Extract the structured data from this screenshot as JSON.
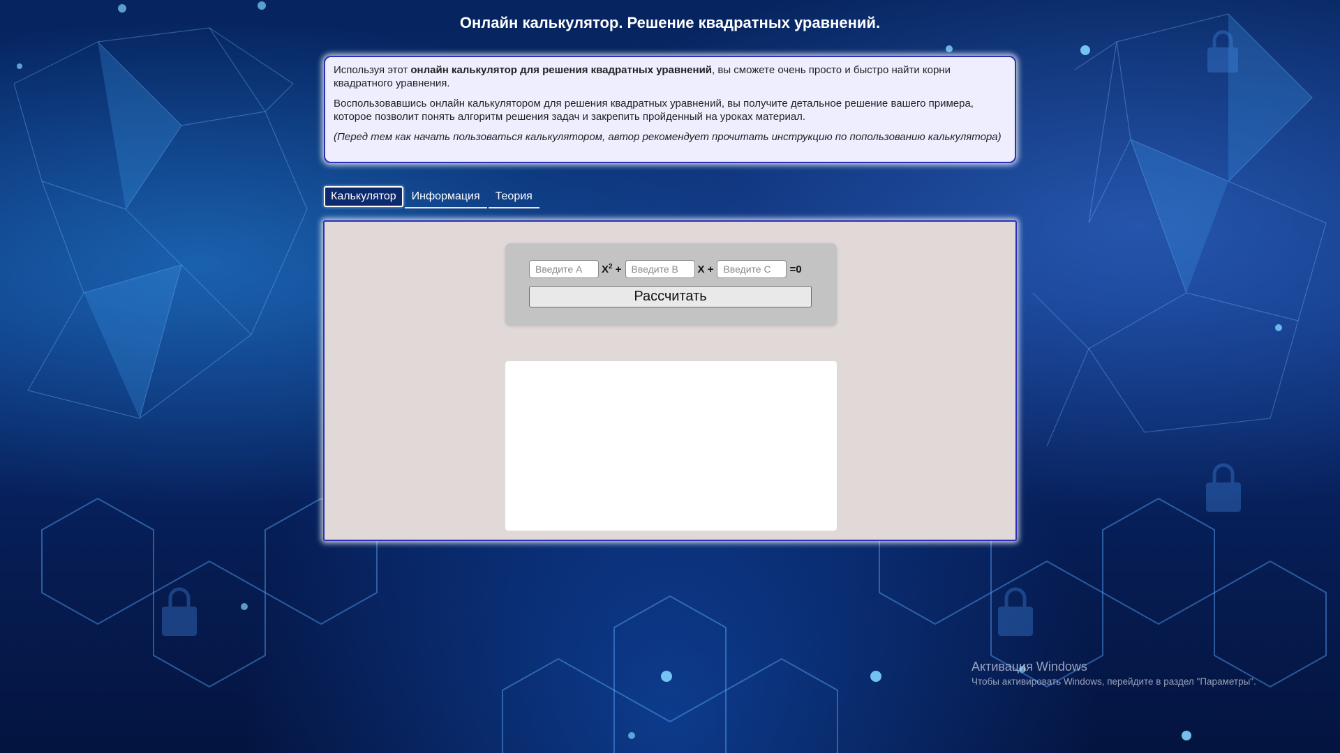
{
  "page": {
    "title": "Онлайн калькулятор. Решение квадратных уравнений."
  },
  "intro": {
    "p1_before": "Используя этот ",
    "p1_bold": "онлайн калькулятор для решения квадратных уравнений",
    "p1_after": ", вы сможете очень просто и быстро найти корни квадратного уравнения.",
    "p2": "Воспользовавшись онлайн калькулятором для решения квадратных уравнений, вы получите детальное решение вашего примера, которое позволит понять алгоритм решения задач и закрепить пройденный на уроках материал.",
    "note": "(Перед тем как начать пользоваться калькулятором, автор рекомендует прочитать инструкцию по попользованию калькулятора)"
  },
  "tabs": [
    {
      "label": "Калькулятор",
      "active": true
    },
    {
      "label": "Информация",
      "active": false
    },
    {
      "label": "Теория",
      "active": false
    }
  ],
  "calculator": {
    "input_a_placeholder": "Введите А",
    "input_a_value": "",
    "x2_symbol": "X",
    "x2_power": "2",
    "plus1": "+",
    "input_b_placeholder": "Введите В",
    "input_b_value": "",
    "x_symbol": "X +",
    "input_c_placeholder": "Введите С",
    "input_c_value": "",
    "equals": "=0",
    "button_label": "Рассчитать"
  },
  "result": {
    "text": ""
  },
  "watermark": {
    "title": "Активация Windows",
    "subtitle": "Чтобы активировать Windows, перейдите в раздел \"Параметры\"."
  },
  "colors": {
    "background": "#0a2e78",
    "panel_border": "#2d2fb8",
    "intro_background": "#eeeeff",
    "panel_background": "#e1d8d8",
    "form_background": "#c3c3c3"
  }
}
